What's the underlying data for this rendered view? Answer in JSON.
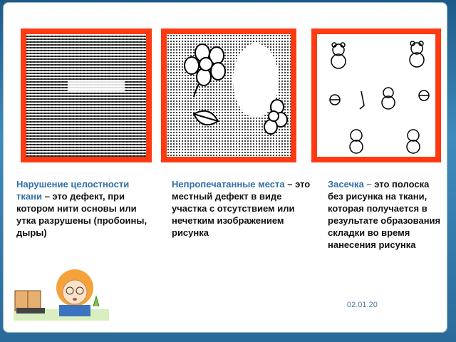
{
  "panels": [
    {
      "title_hl": "Нарушение целостности ткани",
      "rest": " – это дефект, при котором нити основы или утка разрушены (пробоины, дыры)"
    },
    {
      "title_hl": "Непропечатанные места",
      "rest": " – это местный дефект в виде участка с отсутствием или нечетким изображением рисунка"
    },
    {
      "title_hl": "Засечка –",
      "rest": " это полоска без рисунка на ткани, которая получается в результате образования складки во время нанесения рисунка"
    }
  ],
  "date": "02.01.20",
  "colors": {
    "frame": "#ff3a12",
    "highlight": "#2f6ea8"
  },
  "icons": [
    "weave-fabric-icon",
    "flower-icon",
    "leaf-icon",
    "teddy-bear-icon",
    "ball-icon",
    "girl-reading-icon",
    "book-icon"
  ]
}
